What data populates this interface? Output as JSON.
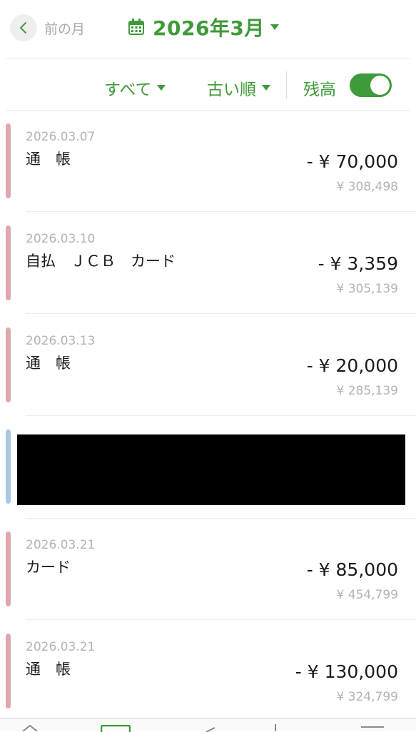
{
  "header": {
    "back_label": "前の月",
    "month_title": "2026年3月"
  },
  "filters": {
    "type_label": "すべて",
    "sort_label": "古い順",
    "balance_label": "残高",
    "balance_toggle_on": true
  },
  "transactions": [
    {
      "date": "2026.03.07",
      "desc": "通　帳",
      "amount": "- ¥ 70,000",
      "balance": "¥ 308,498"
    },
    {
      "date": "2026.03.10",
      "desc": "自払　ＪＣＢ　カード",
      "amount": "- ¥ 3,359",
      "balance": "¥ 305,139"
    },
    {
      "date": "2026.03.13",
      "desc": "通　帳",
      "amount": "- ¥ 20,000",
      "balance": "¥ 285,139"
    },
    {
      "date": "2026.03.21",
      "desc": "カード",
      "amount": "- ¥ 85,000",
      "balance": "¥ 454,799"
    },
    {
      "date": "2026.03.21",
      "desc": "通　帳",
      "amount": "- ¥ 130,000",
      "balance": "¥ 324,799"
    }
  ],
  "colors": {
    "accent": "#3f9a3a",
    "expense_bar": "#e1a7ae",
    "income_bar": "#a8c9e4"
  }
}
